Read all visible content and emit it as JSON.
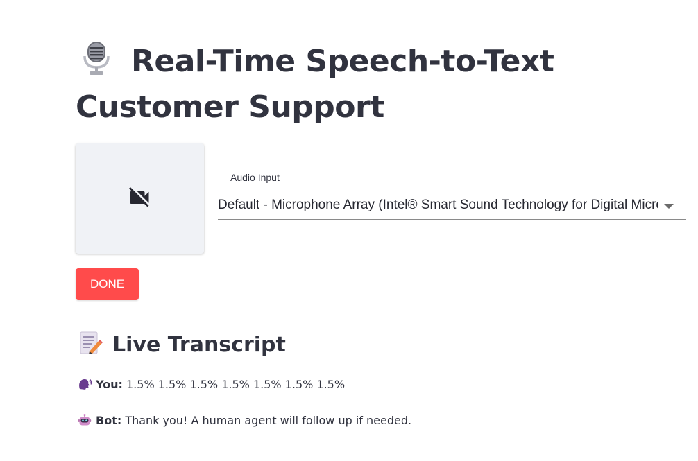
{
  "header": {
    "title": "Real-Time Speech-to-Text Customer Support",
    "title_icon": "microphone-icon"
  },
  "video": {
    "icon": "video-off-icon"
  },
  "audio_input": {
    "label": "Audio Input",
    "selected": "Default - Microphone Array (Intel® Smart Sound Technology for Digital Microphones)"
  },
  "controls": {
    "done_label": "DONE",
    "done_color": "#ff4b4b"
  },
  "transcript": {
    "title": "Live Transcript",
    "title_icon": "memo-icon",
    "messages": [
      {
        "speaker": "You:",
        "text": "1.5% 1.5% 1.5% 1.5% 1.5% 1.5% 1.5%",
        "icon": "speaking-head-icon"
      },
      {
        "speaker": "Bot:",
        "text": "Thank you! A human agent will follow up if needed.",
        "icon": "robot-icon"
      }
    ]
  },
  "colors": {
    "text": "#31333f",
    "video_bg": "#f0f2f6"
  }
}
